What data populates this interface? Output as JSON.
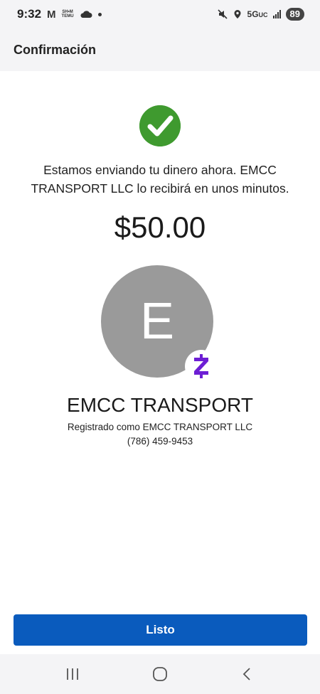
{
  "status_bar": {
    "time": "9:32",
    "gmail_glyph": "M",
    "temu_label_top": "SH•M",
    "temu_label_bottom": "TEMU",
    "network": "5G",
    "network_sub": "UC",
    "battery": "89"
  },
  "header": {
    "title": "Confirmación"
  },
  "confirmation": {
    "status_icon": "check-circle-icon",
    "message": "Estamos enviando tu dinero ahora. EMCC TRANSPORT LLC lo recibirá en unos minutos.",
    "amount": "$50.00"
  },
  "recipient": {
    "initial": "E",
    "avatar_color": "#9a9a9a",
    "badge_icon": "zelle-icon",
    "name": "EMCC TRANSPORT",
    "registered_as": "Registrado como EMCC TRANSPORT LLC",
    "phone": "(786) 459-9453"
  },
  "actions": {
    "done_label": "Listo"
  },
  "nav": {
    "recents_icon": "recents-icon",
    "home_icon": "home-icon",
    "back_icon": "back-icon"
  },
  "colors": {
    "accent": "#0a5bbd",
    "success": "#3f9a2f",
    "zelle": "#6d1ed4",
    "chrome_bg": "#f4f4f6"
  }
}
